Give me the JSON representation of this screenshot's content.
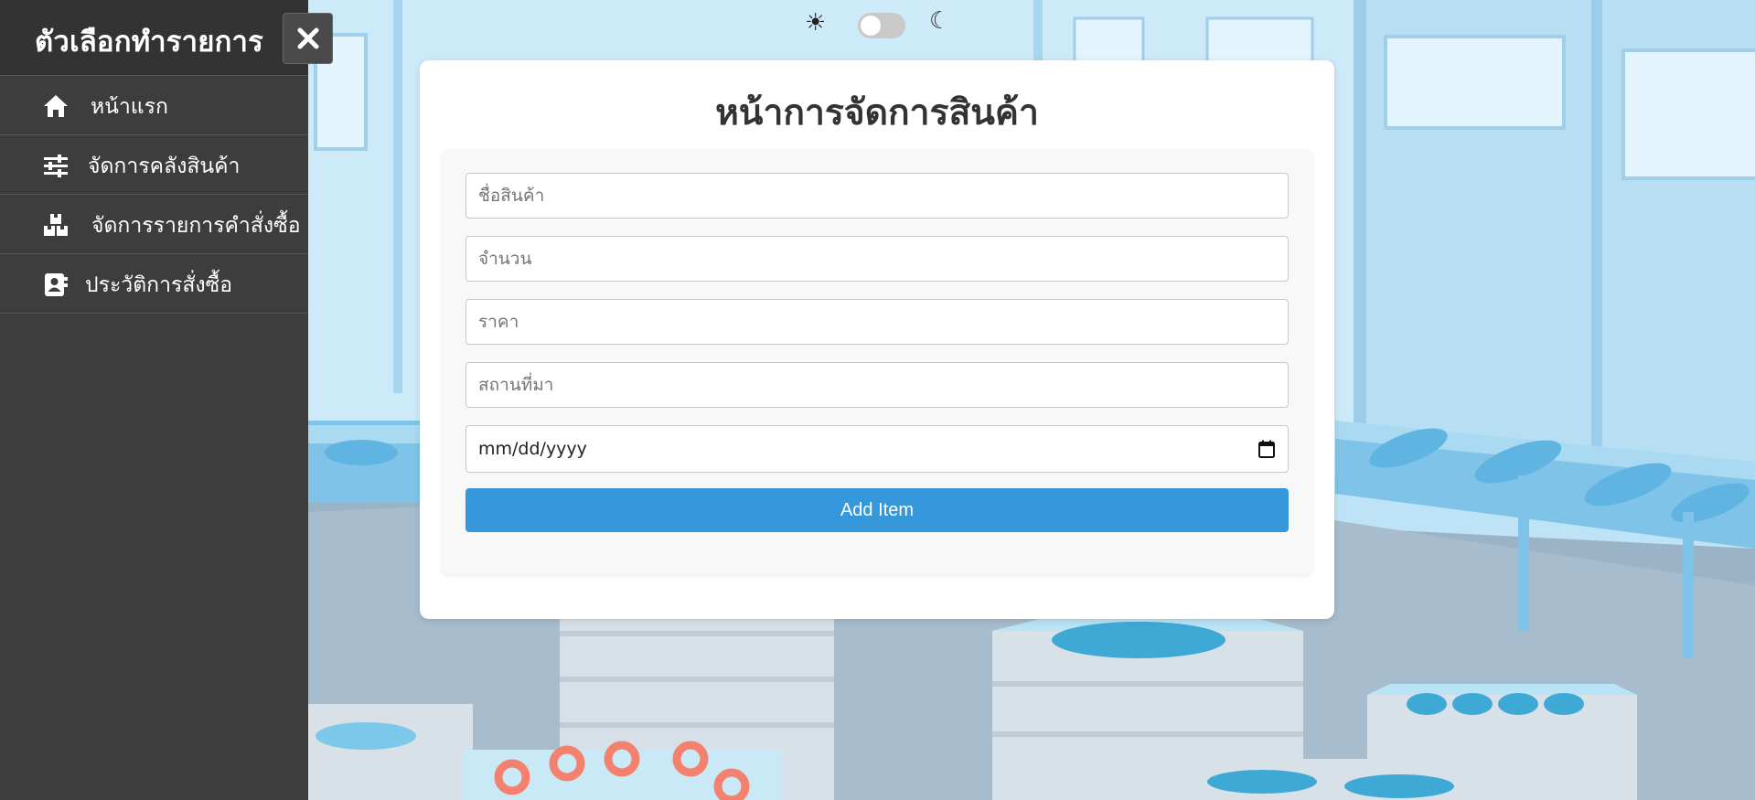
{
  "sidebar": {
    "title": "ตัวเลือกทำรายการ",
    "close_label": "×",
    "items": [
      {
        "label": "หน้าแรก",
        "icon": "home-icon"
      },
      {
        "label": "จัดการคลังสินค้า",
        "icon": "sliders-icon"
      },
      {
        "label": "จัดการรายการคำสั่งซื้อ",
        "icon": "boxes-icon"
      },
      {
        "label": "ประวัติการสั่งซื้อ",
        "icon": "address-book-icon"
      }
    ]
  },
  "theme_toggle": {
    "light_symbol": "☀",
    "dark_symbol": "☾",
    "dark_mode": false
  },
  "main": {
    "title": "หน้าการจัดการสินค้า",
    "form": {
      "product_name_placeholder": "ชื่อสินค้า",
      "quantity_placeholder": "จำนวน",
      "price_placeholder": "ราคา",
      "source_placeholder": "สถานที่มา",
      "date_placeholder": "mm/dd/yyyy",
      "submit_label": "Add Item"
    }
  },
  "colors": {
    "sidebar_bg": "#3d3d3d",
    "accent": "#3498db",
    "background": "#bfe3f6"
  }
}
